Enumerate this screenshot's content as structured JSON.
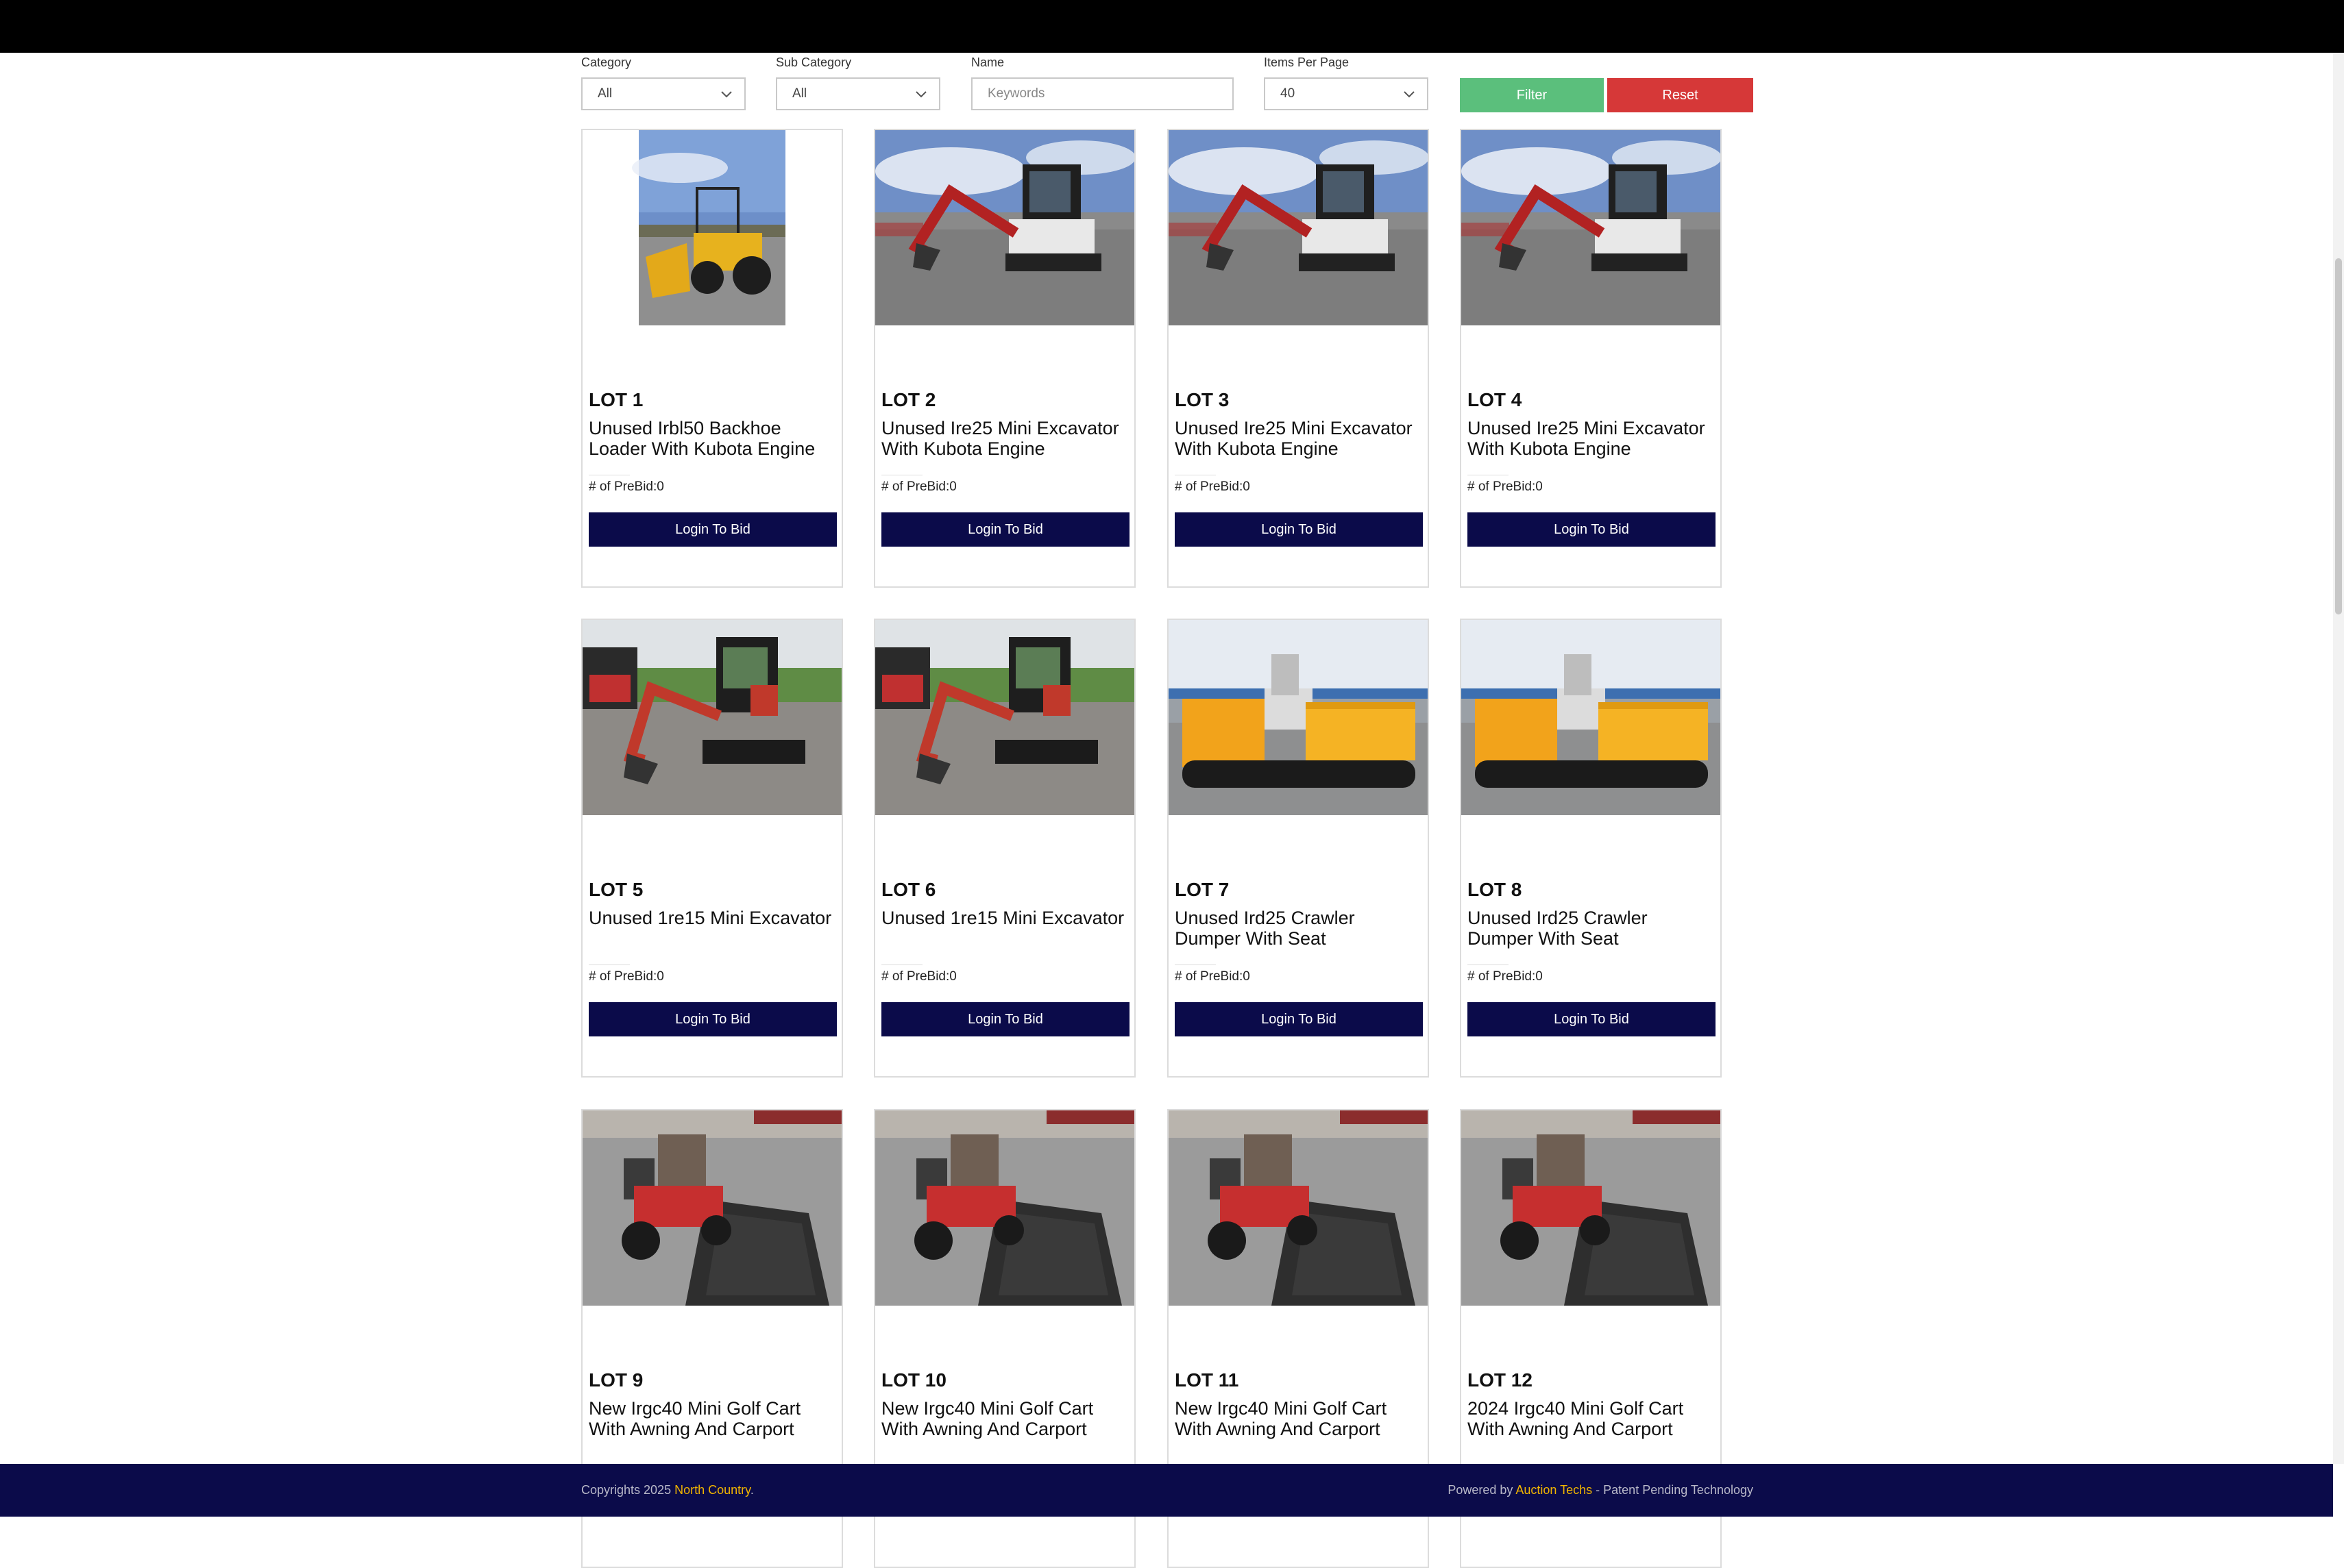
{
  "filters": {
    "category_label": "Category",
    "category_value": "All",
    "subcategory_label": "Sub Category",
    "subcategory_value": "All",
    "name_label": "Name",
    "name_placeholder": "Keywords",
    "items_label": "Items Per Page",
    "items_value": "40",
    "filter_label": "Filter",
    "reset_label": "Reset"
  },
  "lots": [
    {
      "lot": "LOT 1",
      "title": "Unused Irbl50 Backhoe Loader With Kubota Engine",
      "prebid": "# of PreBid:0",
      "action": "Login To Bid",
      "image": "backhoe-loader"
    },
    {
      "lot": "LOT 2",
      "title": "Unused Ire25 Mini Excavator With Kubota Engine",
      "prebid": "# of PreBid:0",
      "action": "Login To Bid",
      "image": "mini-excavator"
    },
    {
      "lot": "LOT 3",
      "title": "Unused Ire25 Mini Excavator With Kubota Engine",
      "prebid": "# of PreBid:0",
      "action": "Login To Bid",
      "image": "mini-excavator"
    },
    {
      "lot": "LOT 4",
      "title": "Unused Ire25 Mini Excavator With Kubota Engine",
      "prebid": "# of PreBid:0",
      "action": "Login To Bid",
      "image": "mini-excavator"
    },
    {
      "lot": "LOT 5",
      "title": "Unused 1re15 Mini Excavator",
      "prebid": "# of PreBid:0",
      "action": "Login To Bid",
      "image": "mini-excavator-grass"
    },
    {
      "lot": "LOT 6",
      "title": "Unused 1re15 Mini Excavator",
      "prebid": "# of PreBid:0",
      "action": "Login To Bid",
      "image": "mini-excavator-grass"
    },
    {
      "lot": "LOT 7",
      "title": "Unused Ird25 Crawler Dumper With Seat",
      "prebid": "# of PreBid:0",
      "action": "Login To Bid",
      "image": "crawler-dumper"
    },
    {
      "lot": "LOT 8",
      "title": "Unused Ird25 Crawler Dumper With Seat",
      "prebid": "# of PreBid:0",
      "action": "Login To Bid",
      "image": "crawler-dumper"
    },
    {
      "lot": "LOT 9",
      "title": "New Irgc40 Mini Golf Cart With Awning And Carport",
      "prebid": "",
      "action": "",
      "image": "golf-cart"
    },
    {
      "lot": "LOT 10",
      "title": "New Irgc40 Mini Golf Cart With Awning And Carport",
      "prebid": "",
      "action": "",
      "image": "golf-cart"
    },
    {
      "lot": "LOT 11",
      "title": "New Irgc40 Mini Golf Cart With Awning And Carport",
      "prebid": "",
      "action": "",
      "image": "golf-cart"
    },
    {
      "lot": "LOT 12",
      "title": "2024 Irgc40 Mini Golf Cart With Awning And Carport",
      "prebid": "",
      "action": "",
      "image": "golf-cart"
    }
  ],
  "footer": {
    "copyright_prefix": "Copyrights 2025 ",
    "company": "North Country",
    "copyright_suffix": ".",
    "powered_prefix": "Powered by ",
    "powered_brand": "Auction Techs",
    "powered_suffix": " - Patent Pending Technology"
  },
  "colors": {
    "filter": "#5bbf7c",
    "reset": "#d63838",
    "navy": "#0b0b4a",
    "gold": "#f0b400"
  }
}
